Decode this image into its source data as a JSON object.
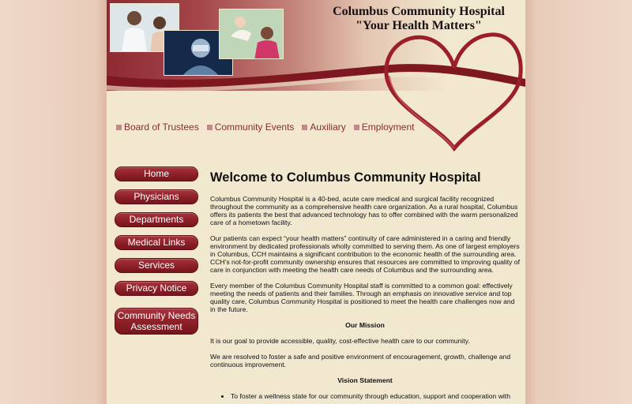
{
  "header": {
    "hospital_name": "Columbus Community Hospital",
    "tagline": "\"Your Health Matters\"",
    "photos": [
      "doctor-with-child-photo",
      "surgeon-photo",
      "mother-with-baby-photo"
    ]
  },
  "top_nav": [
    {
      "label": "Board of Trustees"
    },
    {
      "label": "Community Events"
    },
    {
      "label": "Auxiliary"
    },
    {
      "label": "Employment"
    }
  ],
  "side_nav": [
    {
      "label": "Home"
    },
    {
      "label": "Physicians"
    },
    {
      "label": "Departments"
    },
    {
      "label": "Medical Links"
    },
    {
      "label": "Services"
    },
    {
      "label": "Privacy Notice"
    },
    {
      "label_line1": "Community Needs",
      "label_line2": "Assessment"
    }
  ],
  "content": {
    "title": "Welcome to Columbus Community Hospital",
    "para1": "Columbus Community Hospital is a 40-bed, acute care medical and surgical facility recognized throughout the community as a comprehensive health care organization. As a rural hospital, Columbus offers its patients the best that advanced technology has to offer combined with the warm personalized care of a hometown facility.",
    "para2": "Our patients can expect “your health matters” continuity of care administered in a caring and friendly environment by dedicated professionals wholly committed to serving them. As one of largest employers in Columbus, CCH maintains a significant contribution to the economic health of the surrounding area. CCH’s not-for-profit community ownership ensures that resources are committed to improving quality of care in conjunction with meeting the health care needs of Columbus and the surrounding area.",
    "para3": "Every member of the Columbus Community Hospital staff is committed to a common goal: effectively meeting the needs of patients and their families. Through an emphasis on innovative service and top quality care, Columbus Community Hospital is positioned to meet the health care challenges now and in the future.",
    "mission_heading": "Our Mission",
    "mission1": "It is our goal to provide accessible, quality, cost-effective health care to our community.",
    "mission2": "We are resolved to foster a safe and positive environment of encouragement, growth, challenge and continuous improvement.",
    "vision_heading": "Vision Statement",
    "vision_items": [
      "To foster a wellness state for our community through education, support and cooperation with"
    ]
  },
  "colors": {
    "accent": "#8c1f28",
    "background": "#f2e8d0",
    "link": "#8a2a30"
  }
}
